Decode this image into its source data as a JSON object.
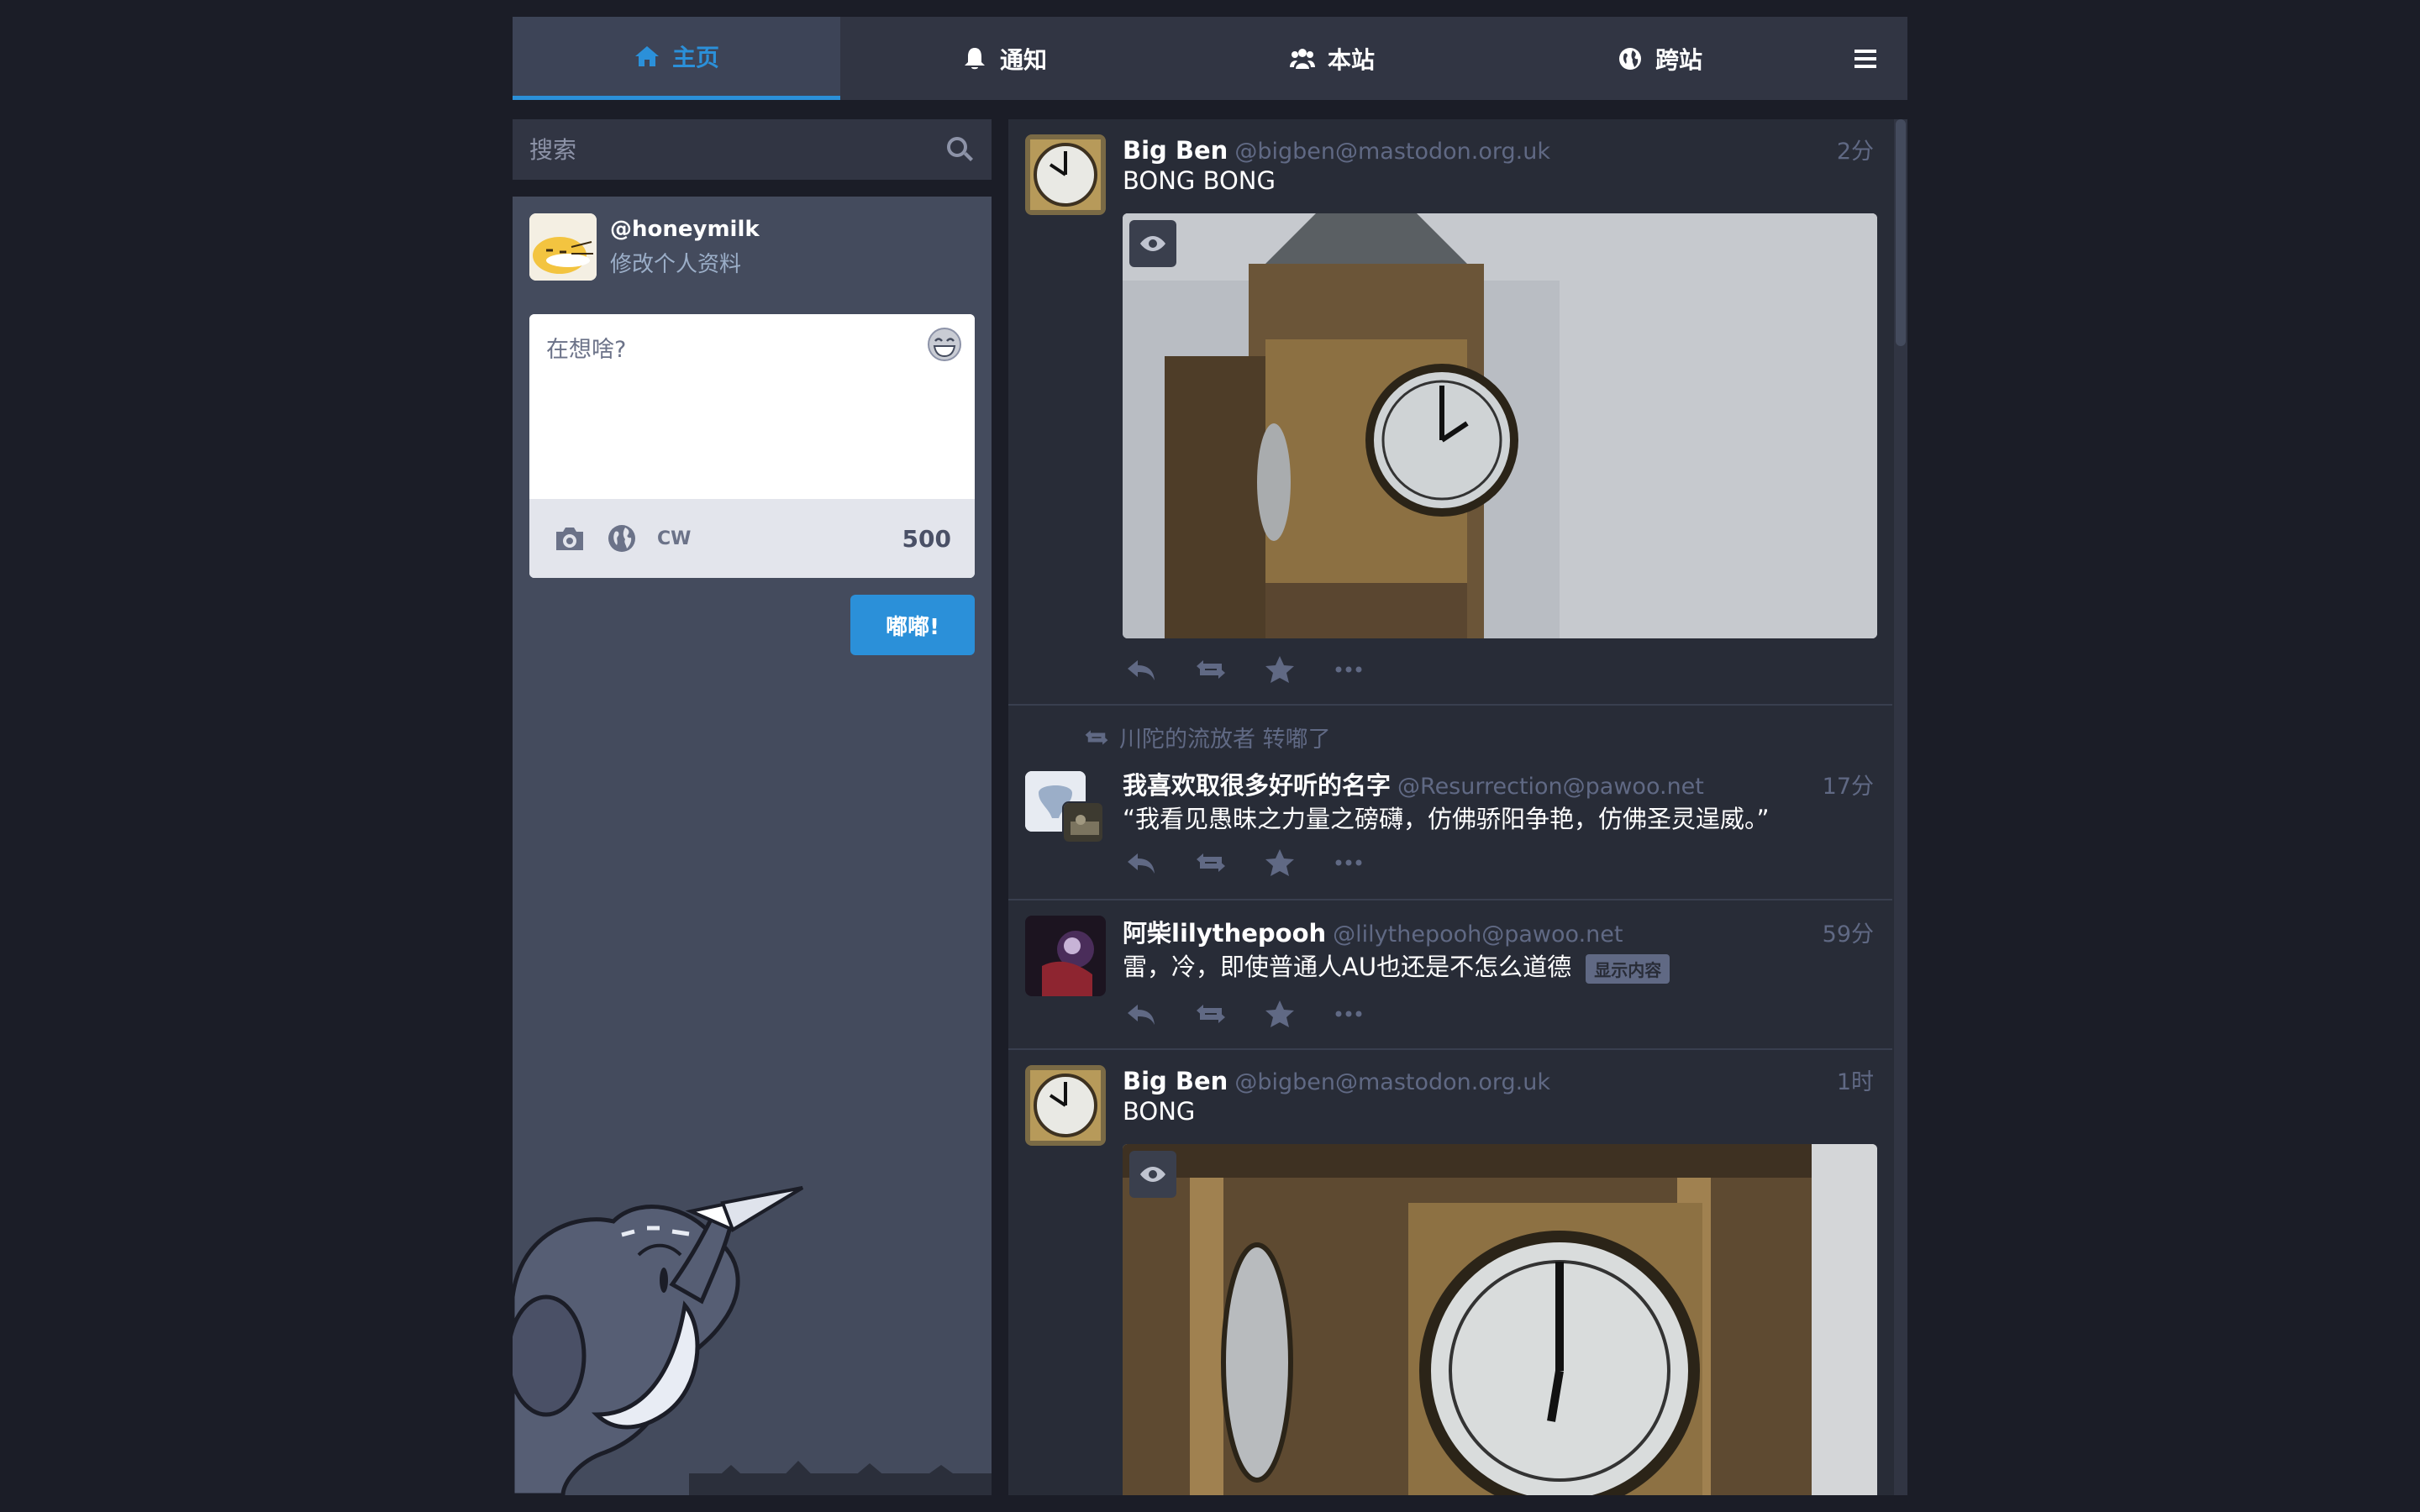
{
  "tabs": [
    {
      "label": "主页",
      "icon": "home-icon",
      "active": true
    },
    {
      "label": "通知",
      "icon": "bell-icon",
      "active": false
    },
    {
      "label": "本站",
      "icon": "users-icon",
      "active": false
    },
    {
      "label": "跨站",
      "icon": "globe-icon",
      "active": false
    }
  ],
  "menu_icon": "hamburger-menu-icon",
  "search": {
    "placeholder": "搜索"
  },
  "profile": {
    "handle": "@honeymilk",
    "edit_label": "修改个人资料"
  },
  "composer": {
    "placeholder": "在想啥?",
    "cw_label": "CW",
    "char_count": "500",
    "submit_label": "嘟嘟!"
  },
  "colors": {
    "accent": "#2b90d9",
    "background": "#1b1d27",
    "panel": "#282c37",
    "drawer": "#444b5d",
    "muted": "#606984"
  },
  "timeline": [
    {
      "display_name": "Big Ben",
      "acct": "@bigben@mastodon.org.uk",
      "time": "2分",
      "content": "BONG BONG",
      "media": "clock-tower-photo"
    },
    {
      "reblogged_by": "川陀的流放者 转嘟了",
      "display_name": "我喜欢取很多好听的名字",
      "acct": "@Resurrection@pawoo.net",
      "time": "17分",
      "content": "“我看见愚昧之力量之磅礴，仿佛骄阳争艳，仿佛圣灵逞威。”"
    },
    {
      "display_name": "阿柴lilythepooh",
      "acct": "@lilythepooh@pawoo.net",
      "time": "59分",
      "content": "雷，冷，即使普通人AU也还是不怎么道德",
      "spoiler_button": "显示内容"
    },
    {
      "display_name": "Big Ben",
      "acct": "@bigben@mastodon.org.uk",
      "time": "1时",
      "content": "BONG",
      "media": "clock-face-closeup-photo"
    }
  ]
}
